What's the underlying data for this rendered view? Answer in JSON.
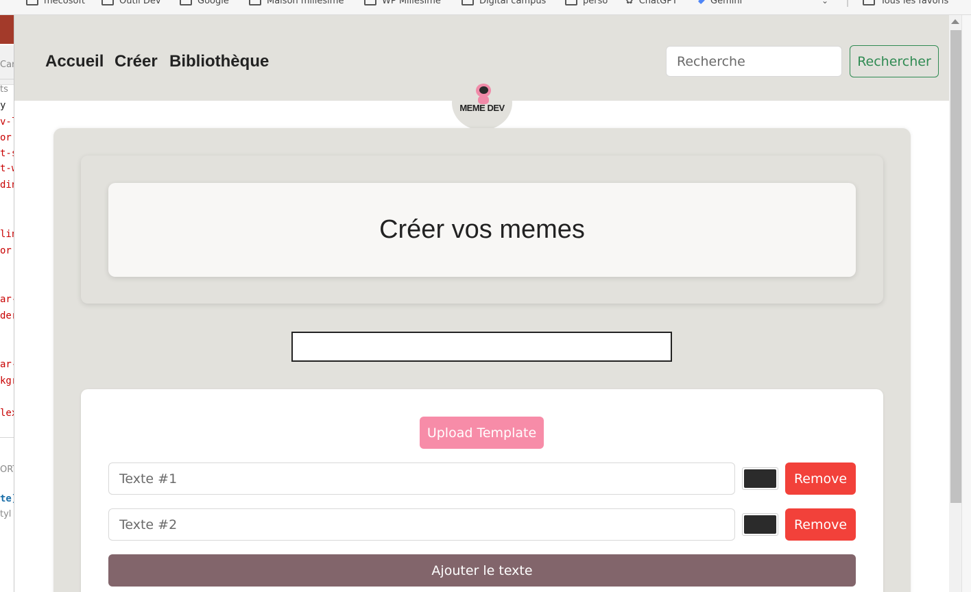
{
  "bookmarks_bar": {
    "items": [
      {
        "label": "mecosoft",
        "icon": "folder-icon"
      },
      {
        "label": "Outil Dev",
        "icon": "folder-icon"
      },
      {
        "label": "Google",
        "icon": "folder-icon"
      },
      {
        "label": "Maison millésime",
        "icon": "folder-icon"
      },
      {
        "label": "WP Millésime",
        "icon": "folder-icon"
      },
      {
        "label": "Digital campus",
        "icon": "folder-icon"
      },
      {
        "label": "perso",
        "icon": "folder-icon"
      },
      {
        "label": "ChatGPT",
        "icon": "chatgpt-icon"
      },
      {
        "label": "Gemini",
        "icon": "gemini-icon"
      }
    ],
    "all_bookmarks": "Tous les favoris"
  },
  "devtools": {
    "lines": [
      {
        "text": "Car",
        "kind": "gray"
      },
      {
        "text": "ts",
        "kind": "gray"
      },
      {
        "text": "y",
        "kind": "black"
      },
      {
        "text": "v-l",
        "kind": "red"
      },
      {
        "text": "or:",
        "kind": "red"
      },
      {
        "text": "t-s",
        "kind": "red"
      },
      {
        "text": "t-w",
        "kind": "red"
      },
      {
        "text": "din",
        "kind": "red"
      },
      {
        "text": "lin",
        "kind": "red"
      },
      {
        "text": "or:",
        "kind": "red"
      },
      {
        "text": "ar-",
        "kind": "red"
      },
      {
        "text": "der",
        "kind": "red"
      },
      {
        "text": "ar-",
        "kind": "red"
      },
      {
        "text": "kgr",
        "kind": "red"
      },
      {
        "text": "lex",
        "kind": "red"
      },
      {
        "text": "ORT",
        "kind": "gray"
      },
      {
        "text": "te]",
        "kind": "blue"
      },
      {
        "text": "tyl",
        "kind": "gray"
      }
    ]
  },
  "nav": {
    "links": [
      "Accueil",
      "Créer",
      "Bibliothèque"
    ],
    "search_placeholder": "Recherche",
    "search_button": "Rechercher"
  },
  "logo": {
    "text": "MEME DEV"
  },
  "page": {
    "title": "Créer vos memes"
  },
  "editor": {
    "upload_button": "Upload Template",
    "texts": [
      {
        "placeholder": "Texte #1",
        "color": "#2b2b2b",
        "remove_label": "Remove"
      },
      {
        "placeholder": "Texte #2",
        "color": "#2b2b2b",
        "remove_label": "Remove"
      }
    ],
    "add_button": "Ajouter le texte"
  },
  "colors": {
    "nav_bg": "#e2e1dc",
    "accent_green": "#2f8a52",
    "upload_pink": "#f78ca8",
    "remove_red": "#f2413a",
    "add_mauve": "#82656b"
  }
}
